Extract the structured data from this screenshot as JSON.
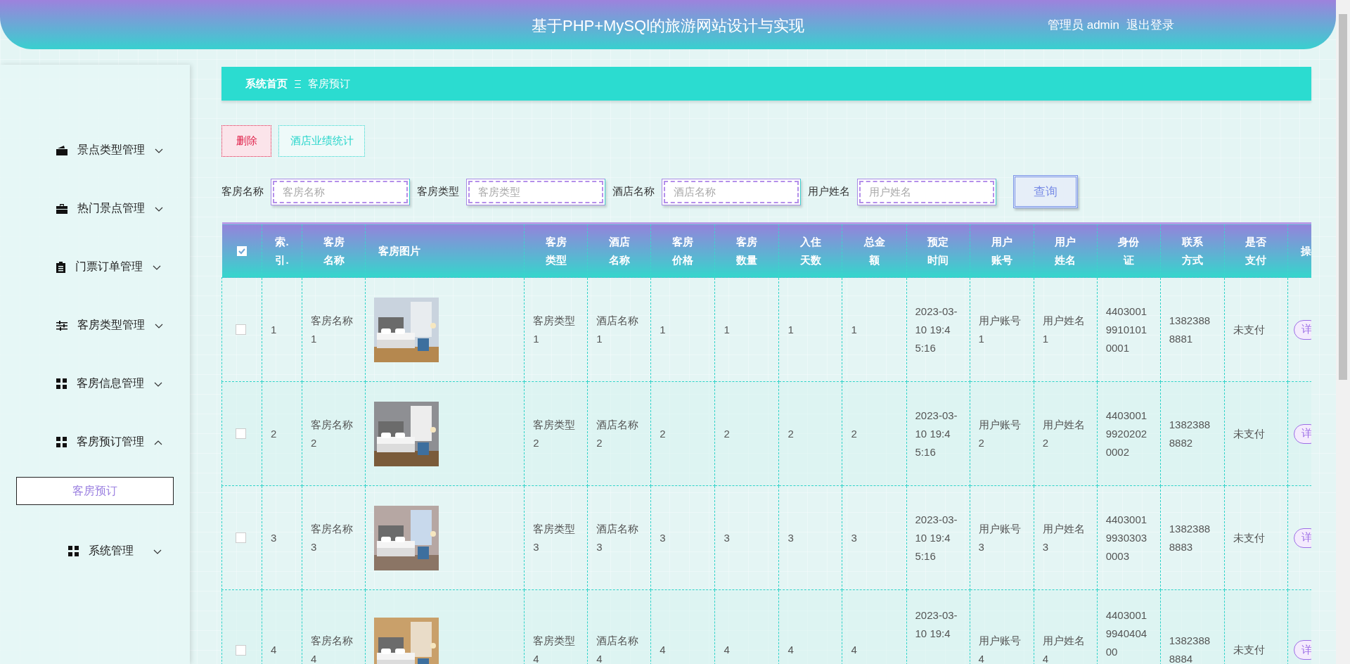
{
  "header": {
    "title": "基于PHP+MySQl的旅游网站设计与实现",
    "user": "管理员 admin",
    "logout": "退出登录"
  },
  "sidebar": {
    "items": [
      {
        "label": "景点类型管理",
        "expanded": false
      },
      {
        "label": "热门景点管理",
        "expanded": false
      },
      {
        "label": "门票订单管理",
        "expanded": false
      },
      {
        "label": "客房类型管理",
        "expanded": false
      },
      {
        "label": "客房信息管理",
        "expanded": false
      },
      {
        "label": "客房预订管理",
        "expanded": true,
        "children": [
          {
            "label": "客房预订",
            "selected": true
          }
        ]
      },
      {
        "label": "系统管理",
        "expanded": false
      }
    ]
  },
  "breadcrumb": [
    "系统首页",
    "客房预订"
  ],
  "actions": [
    {
      "label": "删除",
      "kind": "danger"
    },
    {
      "label": "酒店业绩统计",
      "kind": "plain"
    }
  ],
  "search": {
    "fields": [
      {
        "label": "客房名称",
        "placeholder": "客房名称"
      },
      {
        "label": "客房类型",
        "placeholder": "客房类型"
      },
      {
        "label": "酒店名称",
        "placeholder": "酒店名称"
      },
      {
        "label": "用户姓名",
        "placeholder": "用户姓名"
      }
    ],
    "button": "查询"
  },
  "table": {
    "header_checked": true,
    "columns": [
      "索.引.",
      "客房名称",
      "客房图片",
      "客房类型",
      "酒店名称",
      "客房价格",
      "客房数量",
      "入住天数",
      "总金额",
      "预定时间",
      "用户账号",
      "用户姓名",
      "身份证",
      "联系方式",
      "是否支付",
      "操"
    ],
    "rows": [
      {
        "checked": false,
        "index": "1",
        "name": "客房名称1",
        "type": "客房类型1",
        "hotel": "酒店名称1",
        "price": "1",
        "quantity": "1",
        "days": "1",
        "total": "1",
        "time": "2023-03-10 19:45:16",
        "account": "用户账号1",
        "user": "用户姓名1",
        "id_card": "440300199101010001",
        "phone": "13823888881",
        "paid": "未支付",
        "action": "详"
      },
      {
        "checked": false,
        "index": "2",
        "name": "客房名称2",
        "type": "客房类型2",
        "hotel": "酒店名称2",
        "price": "2",
        "quantity": "2",
        "days": "2",
        "total": "2",
        "time": "2023-03-10 19:45:16",
        "account": "用户账号2",
        "user": "用户姓名2",
        "id_card": "440300199202020002",
        "phone": "13823888882",
        "paid": "未支付",
        "action": "详"
      },
      {
        "checked": false,
        "index": "3",
        "name": "客房名称3",
        "type": "客房类型3",
        "hotel": "酒店名称3",
        "price": "3",
        "quantity": "3",
        "days": "3",
        "total": "3",
        "time": "2023-03-10 19:45:16",
        "account": "用户账号3",
        "user": "用户姓名3",
        "id_card": "440300199303030003",
        "phone": "13823888883",
        "paid": "未支付",
        "action": "详"
      },
      {
        "checked": false,
        "index": "4",
        "name": "客房名称4",
        "type": "客房类型4",
        "hotel": "酒店名称4",
        "price": "4",
        "quantity": "4",
        "days": "4",
        "total": "4",
        "time": "2023-03-10 19:4",
        "account": "用户账号4",
        "user": "用户姓名4",
        "id_card": "4403001994040400",
        "phone": "13823888884",
        "paid": "未支付",
        "action": "详"
      }
    ]
  }
}
